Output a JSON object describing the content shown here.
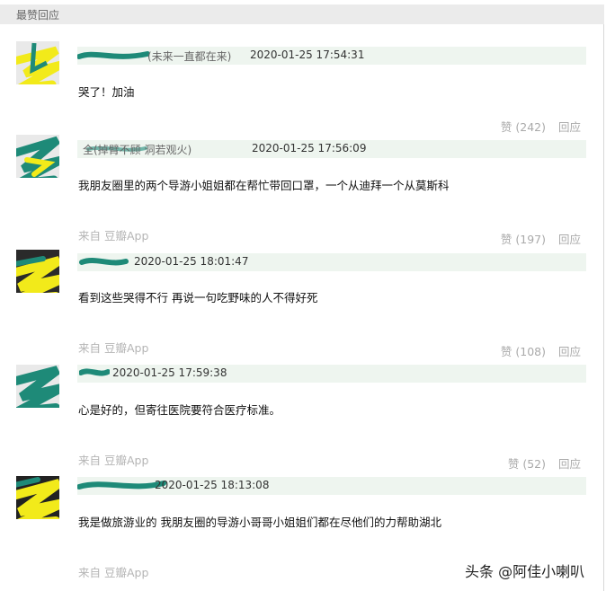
{
  "section": {
    "title": "最赞回应"
  },
  "comments": [
    {
      "user_visible": "(未来一直都在来)",
      "time": "2020-01-25 17:54:31",
      "text": "哭了！加油",
      "source": "",
      "like_label": "赞",
      "like_count": "(242)",
      "reply_label": "回应"
    },
    {
      "user_visible": "全(掉臂不顾 洞若观火)",
      "time": "2020-01-25 17:56:09",
      "text": "我朋友圈里的两个导游小姐姐都在帮忙带回口罩，一个从迪拜一个从莫斯科",
      "source": "来自 豆瓣App",
      "like_label": "赞",
      "like_count": "(197)",
      "reply_label": "回应"
    },
    {
      "user_visible": "",
      "time": "2020-01-25 18:01:47",
      "text": "看到这些哭得不行 再说一句吃野味的人不得好死",
      "source": "来自 豆瓣App",
      "like_label": "赞",
      "like_count": "(108)",
      "reply_label": "回应"
    },
    {
      "user_visible": "",
      "time": "2020-01-25 17:59:38",
      "text": "心是好的，但寄往医院要符合医疗标准。",
      "source": "来自 豆瓣App",
      "like_label": "赞",
      "like_count": "(52)",
      "reply_label": "回应"
    },
    {
      "user_visible": "",
      "time": "2020-01-25 18:13:08",
      "text": "我是做旅游业的 我朋友圈的导游小哥哥小姐姐们都在尽他们的力帮助湖北",
      "source": "来自 豆瓣App",
      "like_label": "",
      "like_count": "",
      "reply_label": ""
    }
  ],
  "watermark": {
    "text": "头条 @阿佳小喇叭"
  },
  "colors": {
    "mask_teal": "#1e8a78",
    "scribble_yellow": "#f2ea1a",
    "meta_bg": "#eef5ef",
    "section_bg": "#ebebeb"
  }
}
